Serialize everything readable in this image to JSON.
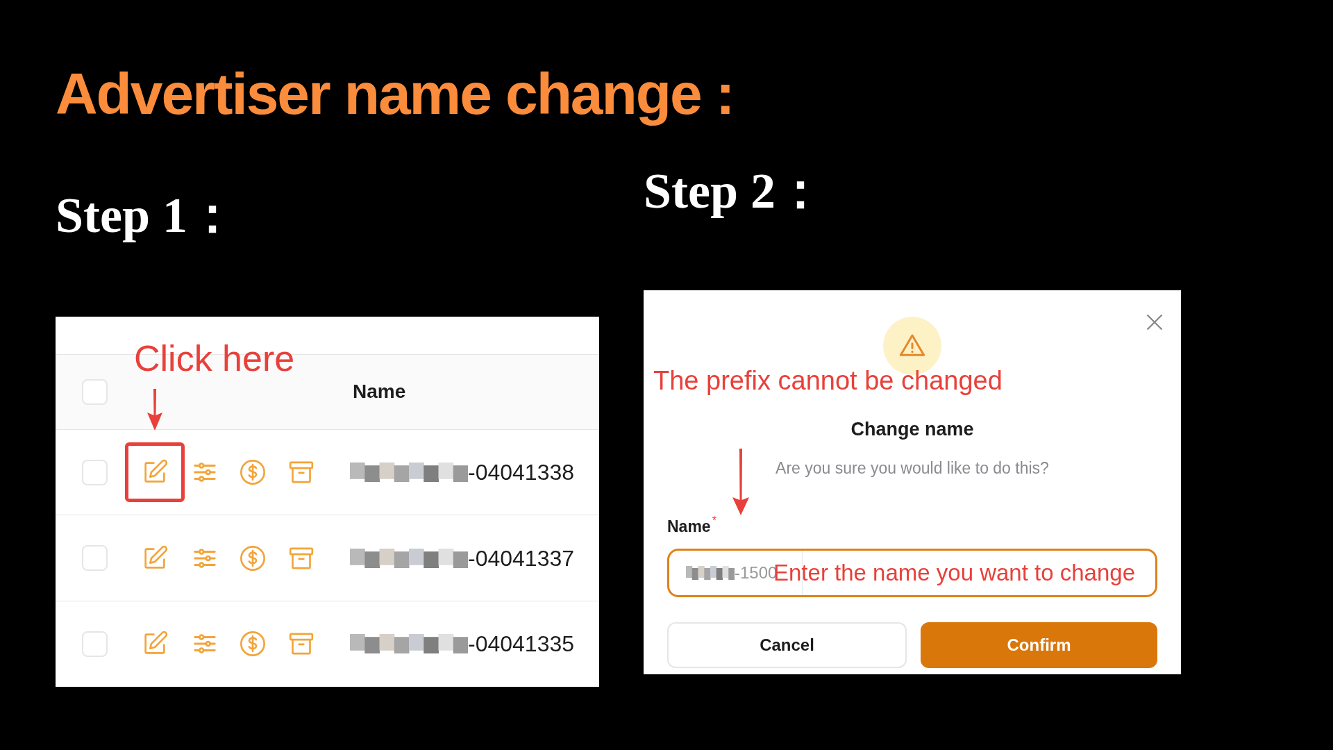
{
  "title": "Advertiser name change :",
  "steps": [
    {
      "label": "Step 1："
    },
    {
      "label": "Step 2："
    }
  ],
  "table": {
    "annotation": "Click here",
    "columns": [
      {
        "label": "Name"
      }
    ],
    "header_checked": false,
    "rows": [
      {
        "checked": false,
        "highlighted": true,
        "name_suffix": "-04041338"
      },
      {
        "checked": false,
        "highlighted": false,
        "name_suffix": "-04041337"
      },
      {
        "checked": false,
        "highlighted": false,
        "name_suffix": "-04041335"
      }
    ]
  },
  "dialog": {
    "annotation": "The prefix cannot be changed",
    "title": "Change name",
    "message": "Are you sure you would like to do this?",
    "field": {
      "label": "Name",
      "required_mark": "*",
      "prefix": "-1500",
      "annotation": "Enter the name you want to change"
    },
    "buttons": [
      {
        "label": "Cancel",
        "kind": "secondary"
      },
      {
        "label": "Confirm",
        "kind": "primary"
      }
    ]
  }
}
